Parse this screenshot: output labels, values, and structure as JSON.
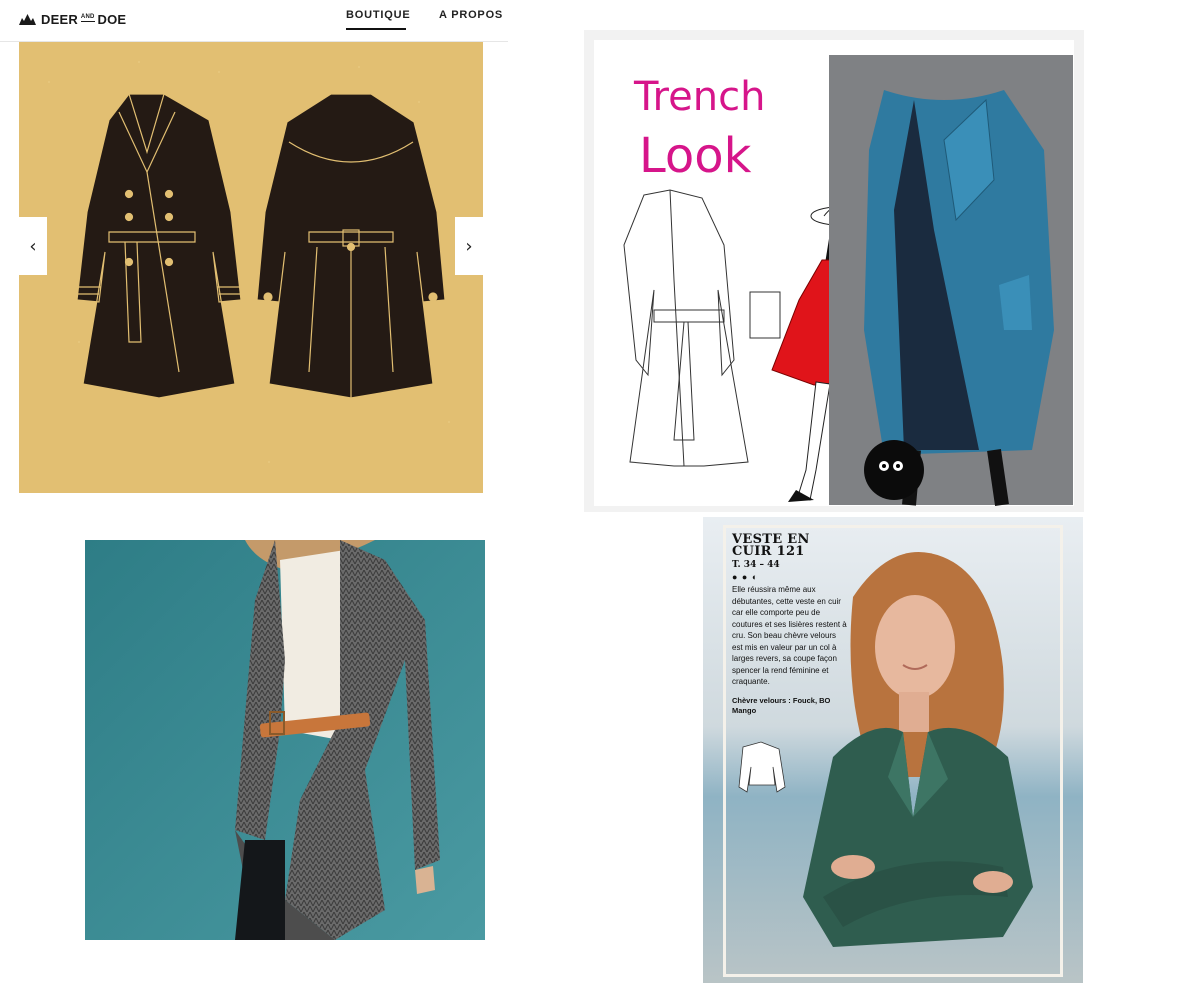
{
  "header": {
    "logo_main": "DEER",
    "logo_and": "AND",
    "logo_end": "DOE",
    "logo_icon": "deer-logo-icon",
    "nav": [
      {
        "label": "BOUTIQUE",
        "active": true
      },
      {
        "label": "A PROPOS",
        "active": false
      }
    ]
  },
  "gallery": {
    "panel1": {
      "prev_icon": "chevron-left-icon",
      "next_icon": "chevron-right-icon",
      "prev_glyph": "‹",
      "next_glyph": "›",
      "background": "#e2bf72"
    },
    "panel2": {
      "title_line1": "Trench",
      "title_line2": "Look",
      "accent": "#d6158a",
      "coat_color": "#2f7aa0",
      "red_coat_color": "#e0141a"
    },
    "panel3": {
      "background": "#3f8890",
      "belt_color": "#c8763b"
    },
    "panel4": {
      "title_line1": "VESTE EN",
      "title_line2": "CUIR 121",
      "sizes": "T. 34 – 44",
      "difficulty": "● ● ◐",
      "body": "Elle réussira même aux débutantes, cette veste en cuir car elle comporte peu de coutures et ses lisières restent à cru. Son beau chèvre velours est mis en valeur par un col à larges revers, sa coupe façon spencer la rend féminine et craquante.",
      "materials": "Chèvre velours : Fouck, BO Mango",
      "jacket_color": "#2f5d4f"
    }
  }
}
